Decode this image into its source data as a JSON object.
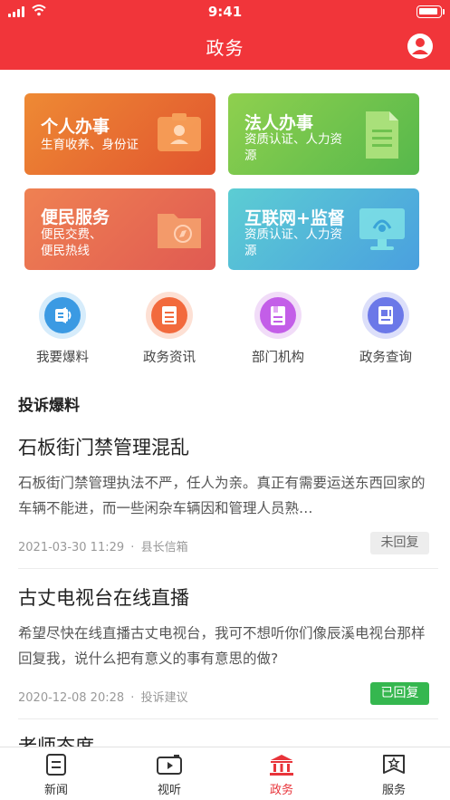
{
  "status_bar": {
    "time": "9:41"
  },
  "header": {
    "title": "政务"
  },
  "cards": [
    {
      "title": "个人办事",
      "subtitle": "生育收养、身份证"
    },
    {
      "title": "法人办事",
      "subtitle": "资质认证、人力资源"
    },
    {
      "title": "便民服务",
      "subtitle": "便民交费、便民热线"
    },
    {
      "title": "互联网+监督",
      "subtitle": "资质认证、人力资源"
    }
  ],
  "quick_entries": [
    {
      "label": "我要爆料",
      "icon": "megaphone-icon"
    },
    {
      "label": "政务资讯",
      "icon": "news-doc-icon"
    },
    {
      "label": "部门机构",
      "icon": "department-icon"
    },
    {
      "label": "政务查询",
      "icon": "search-doc-icon"
    }
  ],
  "section": {
    "title": "投诉爆料"
  },
  "articles": [
    {
      "title": "石板街门禁管理混乱",
      "summary": "石板街门禁管理执法不严，任人为亲。真正有需要运送东西回家的车辆不能进，而一些闲杂车辆因和管理人员熟…",
      "date": "2021-03-30 11:29",
      "category": "县长信箱",
      "status": "未回复"
    },
    {
      "title": "古丈电视台在线直播",
      "summary": "希望尽快在线直播古丈电视台，我可不想听你们像辰溪电视台那样回复我，说什么把有意义的事有意思的做?",
      "date": "2020-12-08 20:28",
      "category": "投诉建议",
      "status": "已回复"
    },
    {
      "title": "老师态度"
    }
  ],
  "meta_separator": "·",
  "tabbar": [
    {
      "label": "新闻",
      "icon": "news-icon"
    },
    {
      "label": "视听",
      "icon": "video-icon"
    },
    {
      "label": "政务",
      "icon": "government-icon",
      "active": true
    },
    {
      "label": "服务",
      "icon": "service-icon"
    }
  ],
  "colors": {
    "brand_red": "#f1353a",
    "status_unreplied_bg": "#ededed",
    "status_replied_bg": "#35b74f"
  }
}
